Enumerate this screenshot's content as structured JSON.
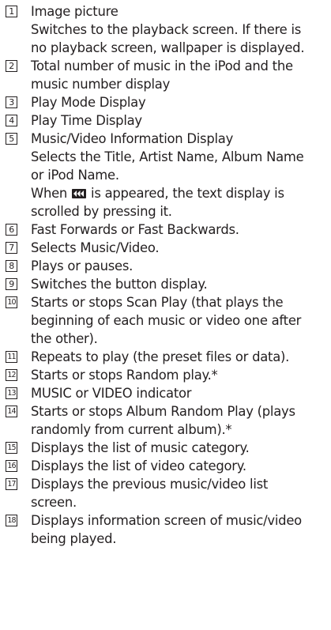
{
  "items": [
    {
      "num": "1",
      "lines": [
        "Image picture",
        "Switches to the playback screen. If there is",
        "no playback screen, wallpaper is displayed."
      ]
    },
    {
      "num": "2",
      "lines": [
        "Total number of music in the iPod and the",
        "music number display"
      ]
    },
    {
      "num": "3",
      "lines": [
        "Play Mode Display"
      ]
    },
    {
      "num": "4",
      "lines": [
        "Play Time Display"
      ]
    },
    {
      "num": "5",
      "lines": [
        "Music/Video Information Display",
        "Selects the Title, Artist Name, Album Name",
        "or iPod Name."
      ],
      "extra": {
        "before": "When",
        "icon": "scroll-icon",
        "after": "is appeared, the text display is",
        "line2": "scrolled by pressing it."
      }
    },
    {
      "num": "6",
      "lines": [
        "Fast Forwards or Fast Backwards."
      ]
    },
    {
      "num": "7",
      "lines": [
        "Selects Music/Video."
      ]
    },
    {
      "num": "8",
      "lines": [
        "Plays or pauses."
      ]
    },
    {
      "num": "9",
      "lines": [
        "Switches the button display."
      ]
    },
    {
      "num": "10",
      "lines": [
        "Starts or stops Scan Play (that plays the",
        "beginning of each music or video one after",
        "the other)."
      ]
    },
    {
      "num": "11",
      "lines": [
        "Repeats to play (the preset files or data)."
      ]
    },
    {
      "num": "12",
      "lines": [
        "Starts or stops Random play.*"
      ]
    },
    {
      "num": "13",
      "lines": [
        "MUSIC or VIDEO indicator"
      ]
    },
    {
      "num": "14",
      "lines": [
        "Starts or stops Album Random Play (plays",
        "randomly from current album).*"
      ]
    },
    {
      "num": "15",
      "lines": [
        "Displays the list of music category."
      ]
    },
    {
      "num": "16",
      "lines": [
        "Displays the list of video category."
      ]
    },
    {
      "num": "17",
      "lines": [
        "Displays the previous music/video list",
        "screen."
      ]
    },
    {
      "num": "18",
      "lines": [
        "Displays information screen of music/video",
        "being played."
      ]
    }
  ]
}
